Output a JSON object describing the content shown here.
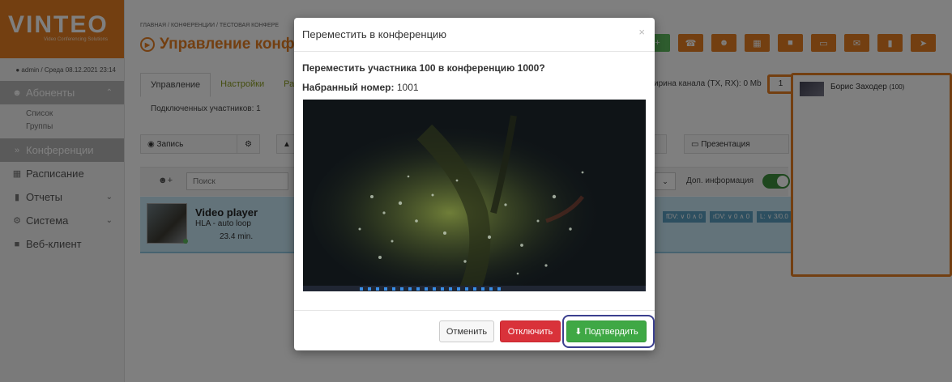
{
  "brand": {
    "name": "VINTEO",
    "tagline": "Video Conferencing Solutions"
  },
  "user_line": "admin / Среда 08.12.2021 23:14",
  "sidebar": {
    "items": [
      {
        "label": "Абоненты",
        "icon": "users-icon"
      },
      {
        "label": "Конференции",
        "icon": "double-chevron-icon"
      },
      {
        "label": "Расписание",
        "icon": "calendar-icon"
      },
      {
        "label": "Отчеты",
        "icon": "book-icon"
      },
      {
        "label": "Система",
        "icon": "cogs-icon"
      },
      {
        "label": "Веб-клиент",
        "icon": "video-camera-icon"
      }
    ],
    "subitems": [
      "Список",
      "Группы"
    ]
  },
  "header": {
    "breadcrumb": "ГЛАВНАЯ / КОНФЕРЕНЦИИ / ТЕСТОВАЯ КОНФЕРЕ",
    "title": "Управление конфер"
  },
  "tabs": [
    "Управление",
    "Настройки",
    "Ра"
  ],
  "connected": "Подключенных участников: 1",
  "bandwidth_label": "ирина канала (TX, RX): 0 Mb",
  "bandwidth_value": "1",
  "controls": {
    "record": "Запись",
    "presentation": "Презентация"
  },
  "list": {
    "search_placeholder": "Поиск",
    "extra_info": "Доп. информация"
  },
  "participant": {
    "name": "Video player",
    "desc": "HLA - auto loop",
    "time": "23.4 min.",
    "stats": [
      "fDV: ∨ 0 ∧ 0",
      "rDV: ∨ 0 ∧ 0",
      "L: ∨ 3/0.0"
    ]
  },
  "right_panel": {
    "name": "Борис Заходер",
    "ext": "(100)",
    "count": "1"
  },
  "modal": {
    "title": "Переместить в конференцию",
    "close": "×",
    "question": "Переместить участника 100 в конференцию 1000?",
    "dialed_label": "Набранный номер:",
    "dialed_value": "1001",
    "buttons": {
      "cancel": "Отменить",
      "disconnect": "Отключить",
      "confirm": "Подтвердить"
    }
  },
  "colors": {
    "accent": "#e67e22",
    "confirm": "#3fa845",
    "disconnect": "#d9323a",
    "highlight_ring": "#3b3f8f"
  }
}
